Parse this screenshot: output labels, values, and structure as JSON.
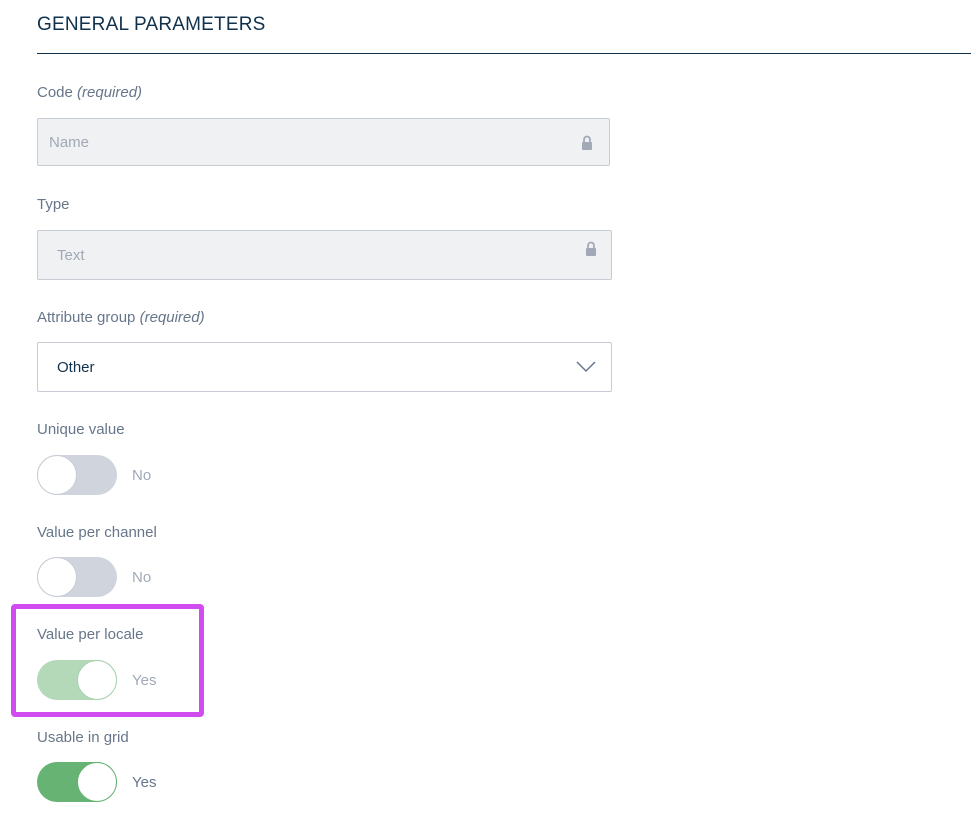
{
  "section": {
    "title": "GENERAL PARAMETERS"
  },
  "fields": {
    "code": {
      "label": "Code",
      "required": "(required)",
      "value": "Name",
      "icon": "lock-icon"
    },
    "type": {
      "label": "Type",
      "value": "Text",
      "icon": "lock-icon"
    },
    "attribute_group": {
      "label": "Attribute group",
      "required": "(required)",
      "value": "Other",
      "icon": "chevron-down-icon"
    }
  },
  "switches": {
    "unique_value": {
      "label": "Unique value",
      "state": "No"
    },
    "value_per_channel": {
      "label": "Value per channel",
      "state": "No"
    },
    "value_per_locale": {
      "label": "Value per locale",
      "state": "Yes"
    },
    "usable_in_grid": {
      "label": "Usable in grid",
      "state": "Yes"
    }
  },
  "colors": {
    "title": "#11324d",
    "label": "#67768a",
    "switch_on": "#67b373",
    "switch_off": "#d0d5dd",
    "highlight": "#d04bf0"
  }
}
